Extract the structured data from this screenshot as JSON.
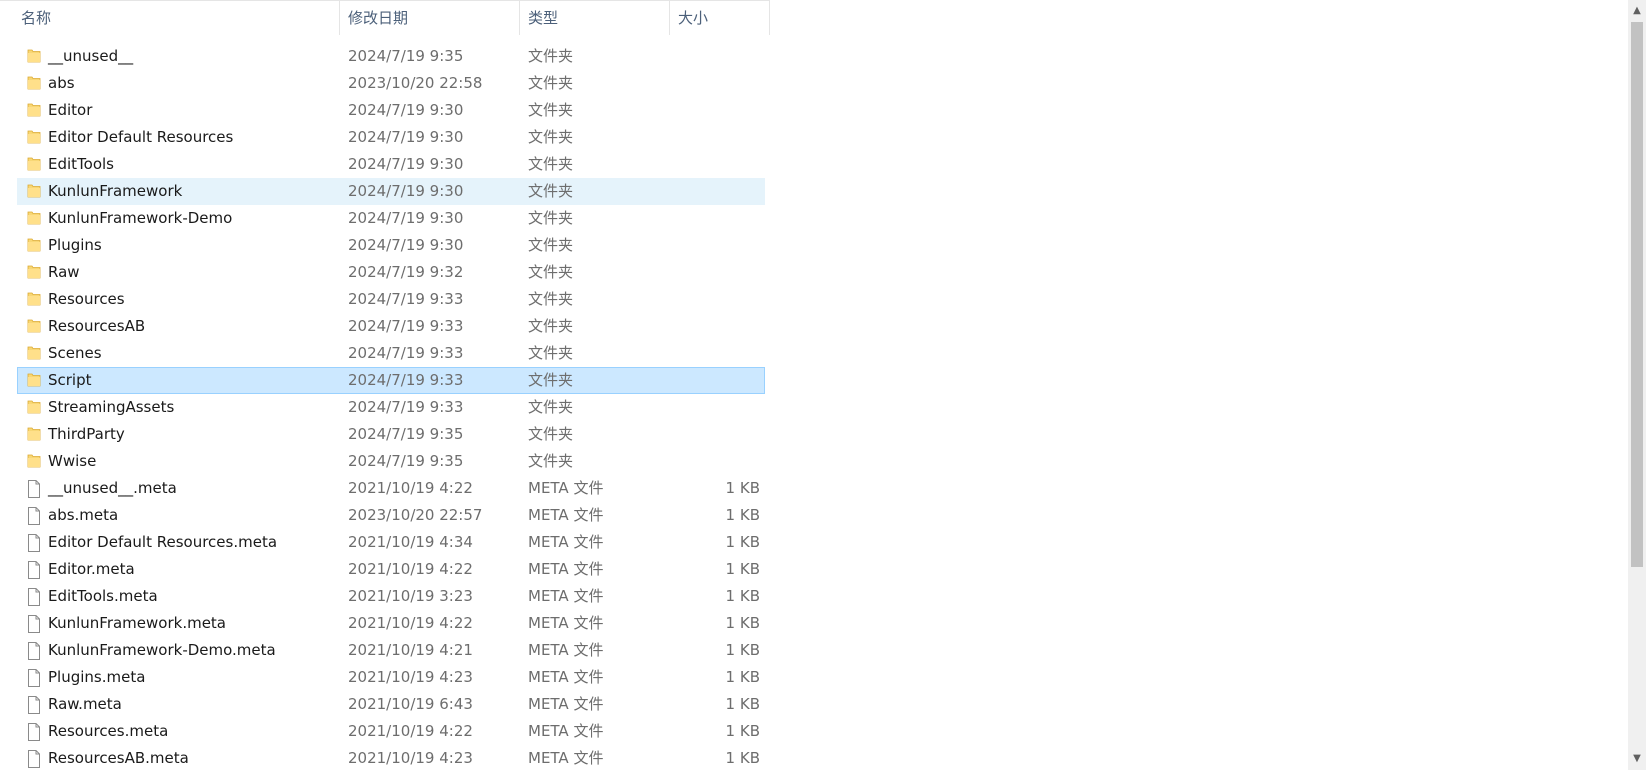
{
  "columns": {
    "name": "名称",
    "date": "修改日期",
    "type": "类型",
    "size": "大小",
    "sort_indicator": "^"
  },
  "scrollbar": {
    "up_arrow": "▲",
    "down_arrow": "▼"
  },
  "rows": [
    {
      "name": "__unused__",
      "date": "2024/7/19 9:35",
      "type": "文件夹",
      "size": "",
      "kind": "folder"
    },
    {
      "name": "abs",
      "date": "2023/10/20 22:58",
      "type": "文件夹",
      "size": "",
      "kind": "folder"
    },
    {
      "name": "Editor",
      "date": "2024/7/19 9:30",
      "type": "文件夹",
      "size": "",
      "kind": "folder"
    },
    {
      "name": "Editor Default Resources",
      "date": "2024/7/19 9:30",
      "type": "文件夹",
      "size": "",
      "kind": "folder"
    },
    {
      "name": "EditTools",
      "date": "2024/7/19 9:30",
      "type": "文件夹",
      "size": "",
      "kind": "folder"
    },
    {
      "name": "KunlunFramework",
      "date": "2024/7/19 9:30",
      "type": "文件夹",
      "size": "",
      "kind": "folder",
      "state": "hover"
    },
    {
      "name": "KunlunFramework-Demo",
      "date": "2024/7/19 9:30",
      "type": "文件夹",
      "size": "",
      "kind": "folder"
    },
    {
      "name": "Plugins",
      "date": "2024/7/19 9:30",
      "type": "文件夹",
      "size": "",
      "kind": "folder"
    },
    {
      "name": "Raw",
      "date": "2024/7/19 9:32",
      "type": "文件夹",
      "size": "",
      "kind": "folder"
    },
    {
      "name": "Resources",
      "date": "2024/7/19 9:33",
      "type": "文件夹",
      "size": "",
      "kind": "folder"
    },
    {
      "name": "ResourcesAB",
      "date": "2024/7/19 9:33",
      "type": "文件夹",
      "size": "",
      "kind": "folder"
    },
    {
      "name": "Scenes",
      "date": "2024/7/19 9:33",
      "type": "文件夹",
      "size": "",
      "kind": "folder"
    },
    {
      "name": "Script",
      "date": "2024/7/19 9:33",
      "type": "文件夹",
      "size": "",
      "kind": "folder",
      "state": "selected"
    },
    {
      "name": "StreamingAssets",
      "date": "2024/7/19 9:33",
      "type": "文件夹",
      "size": "",
      "kind": "folder"
    },
    {
      "name": "ThirdParty",
      "date": "2024/7/19 9:35",
      "type": "文件夹",
      "size": "",
      "kind": "folder"
    },
    {
      "name": "Wwise",
      "date": "2024/7/19 9:35",
      "type": "文件夹",
      "size": "",
      "kind": "folder"
    },
    {
      "name": "__unused__.meta",
      "date": "2021/10/19 4:22",
      "type": "META 文件",
      "size": "1 KB",
      "kind": "file"
    },
    {
      "name": "abs.meta",
      "date": "2023/10/20 22:57",
      "type": "META 文件",
      "size": "1 KB",
      "kind": "file"
    },
    {
      "name": "Editor Default Resources.meta",
      "date": "2021/10/19 4:34",
      "type": "META 文件",
      "size": "1 KB",
      "kind": "file"
    },
    {
      "name": "Editor.meta",
      "date": "2021/10/19 4:22",
      "type": "META 文件",
      "size": "1 KB",
      "kind": "file"
    },
    {
      "name": "EditTools.meta",
      "date": "2021/10/19 3:23",
      "type": "META 文件",
      "size": "1 KB",
      "kind": "file"
    },
    {
      "name": "KunlunFramework.meta",
      "date": "2021/10/19 4:22",
      "type": "META 文件",
      "size": "1 KB",
      "kind": "file"
    },
    {
      "name": "KunlunFramework-Demo.meta",
      "date": "2021/10/19 4:21",
      "type": "META 文件",
      "size": "1 KB",
      "kind": "file"
    },
    {
      "name": "Plugins.meta",
      "date": "2021/10/19 4:23",
      "type": "META 文件",
      "size": "1 KB",
      "kind": "file"
    },
    {
      "name": "Raw.meta",
      "date": "2021/10/19 6:43",
      "type": "META 文件",
      "size": "1 KB",
      "kind": "file"
    },
    {
      "name": "Resources.meta",
      "date": "2021/10/19 4:22",
      "type": "META 文件",
      "size": "1 KB",
      "kind": "file"
    },
    {
      "name": "ResourcesAB.meta",
      "date": "2021/10/19 4:23",
      "type": "META 文件",
      "size": "1 KB",
      "kind": "file"
    }
  ]
}
